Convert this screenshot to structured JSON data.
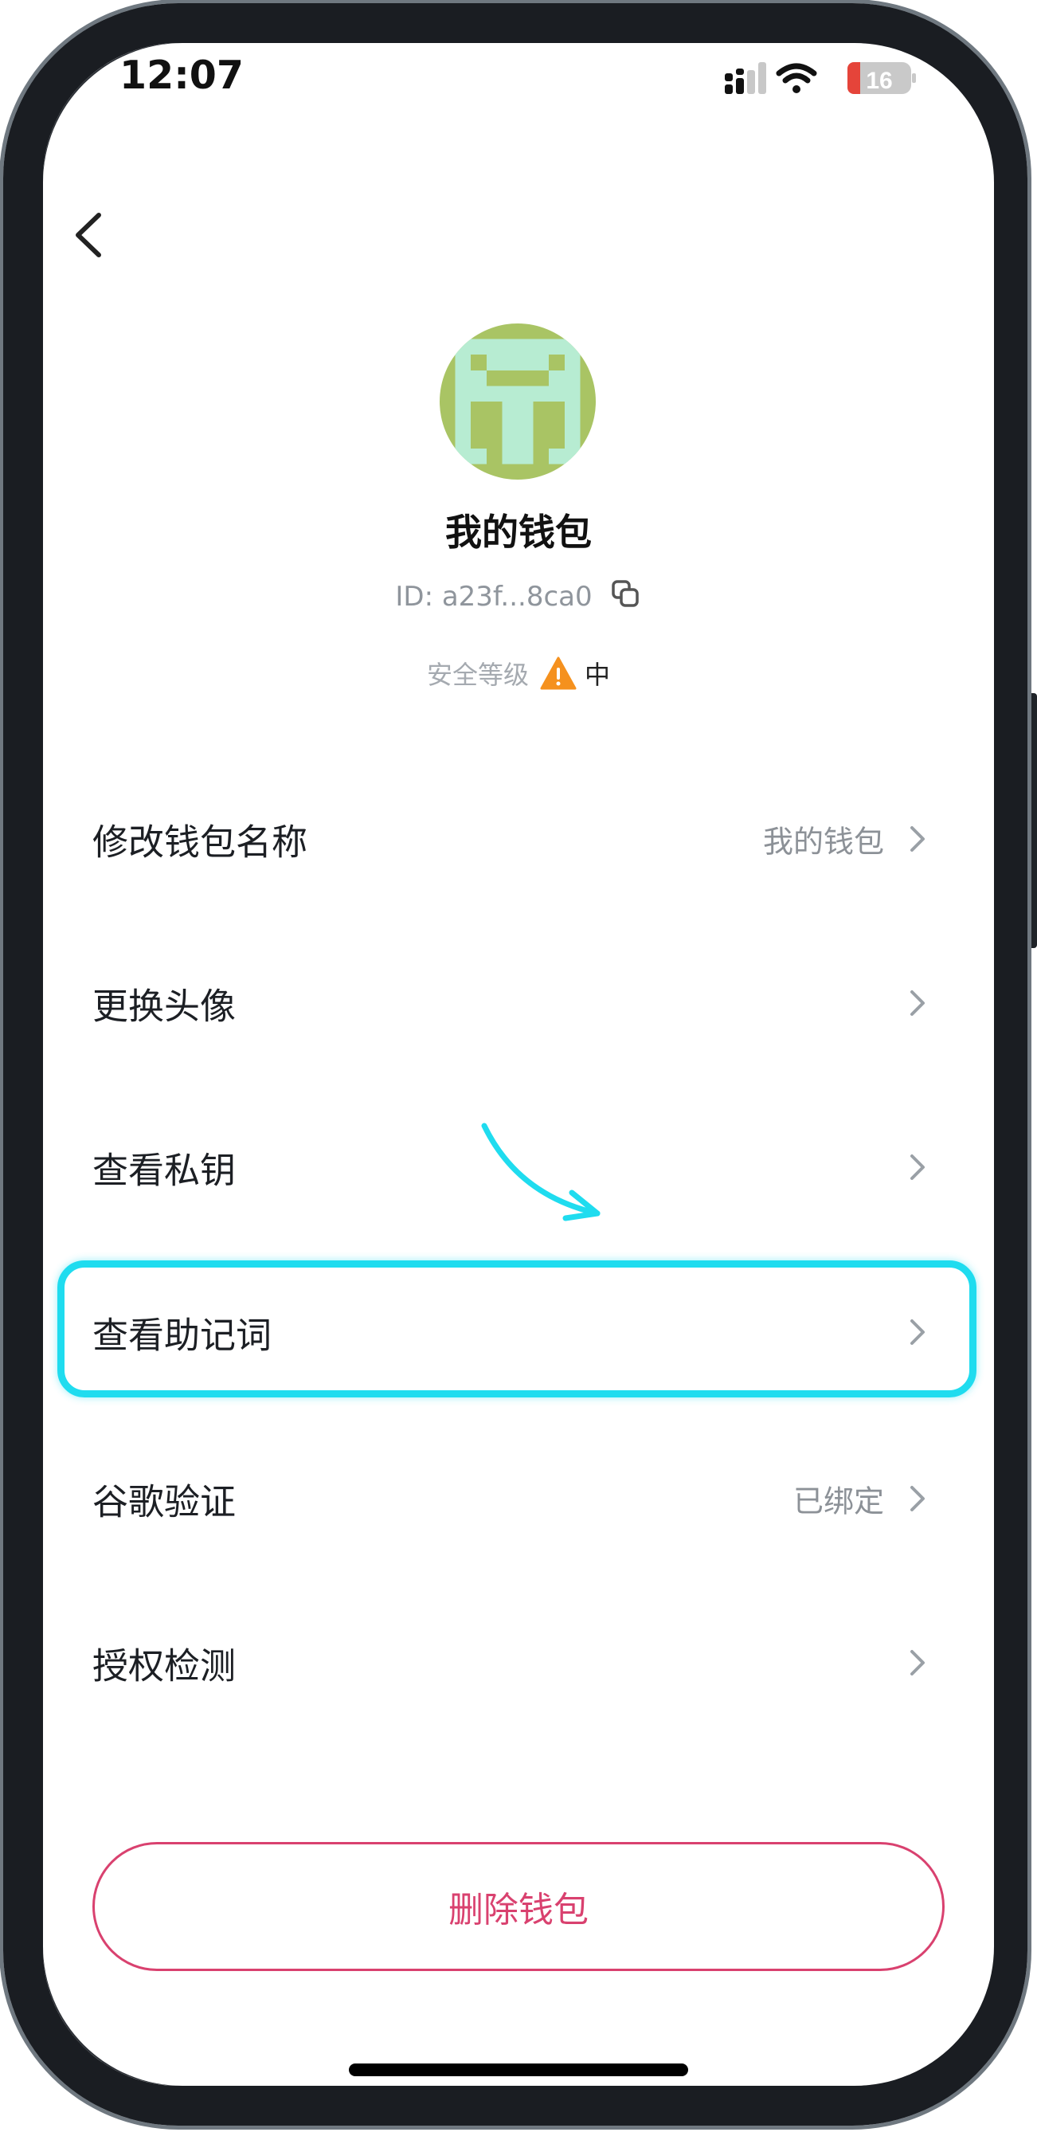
{
  "status_bar": {
    "time": "12:07",
    "battery": "16"
  },
  "profile": {
    "name": "我的钱包",
    "id": "ID: a23f...8ca0",
    "security_label": "安全等级",
    "security_level": "中"
  },
  "menu": [
    {
      "label": "修改钱包名称",
      "value": "我的钱包"
    },
    {
      "label": "更换头像",
      "value": ""
    },
    {
      "label": "查看私钥",
      "value": ""
    },
    {
      "label": "查看助记词",
      "value": ""
    },
    {
      "label": "谷歌验证",
      "value": "已绑定"
    },
    {
      "label": "授权检测",
      "value": ""
    }
  ],
  "delete_label": "删除钱包",
  "colors": {
    "highlight": "#1fdcef",
    "danger": "#d9416f",
    "warning": "#f5911e",
    "avatar_green": "#a9c464",
    "avatar_mint": "#b7ecd2"
  }
}
